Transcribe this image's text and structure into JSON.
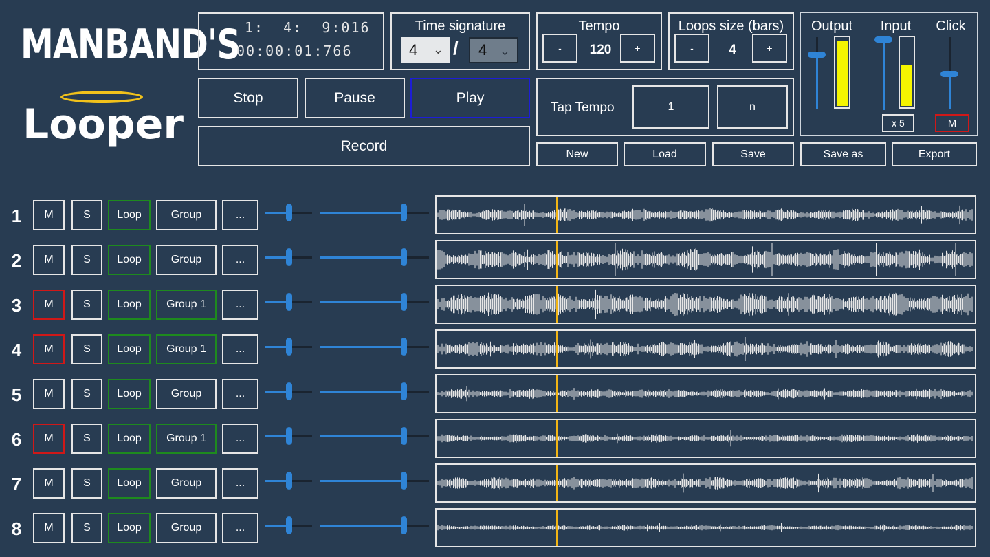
{
  "app": {
    "logo_top": "MANBAND'S",
    "logo_bottom": "Looper"
  },
  "counter": {
    "position": "1:  4:  9:016",
    "time": "00:00:01:766"
  },
  "time_signature": {
    "label": "Time signature",
    "numerator": "4",
    "separator": "/",
    "denominator": "4"
  },
  "tempo": {
    "label": "Tempo",
    "value": "120",
    "minus": "-",
    "plus": "+"
  },
  "loop_size": {
    "label": "Loops size (bars)",
    "value": "4",
    "minus": "-",
    "plus": "+"
  },
  "transport": {
    "stop": "Stop",
    "pause": "Pause",
    "play": "Play",
    "record": "Record"
  },
  "tap_tempo": {
    "label": "Tap Tempo",
    "button1": "1",
    "button2": "n"
  },
  "file": {
    "new": "New",
    "load": "Load",
    "save": "Save",
    "save_as": "Save as",
    "export": "Export"
  },
  "mixer": {
    "output_label": "Output",
    "input_label": "Input",
    "click_label": "Click",
    "input_gain": "x 5",
    "click_mute": "M",
    "output_level": 0.97,
    "input_level": 0.6
  },
  "colors": {
    "background": "#283c52",
    "accent": "#2f84d6",
    "loop_green": "#1e8a1e",
    "mute_red": "#d01818",
    "play_blue": "#1d1dd6",
    "playhead": "#f2b515",
    "meter": "#f5f500"
  },
  "tracks": [
    {
      "number": "1",
      "mute": "M",
      "solo": "S",
      "loop": "Loop",
      "group": "Group",
      "more": "...",
      "muted": false
    },
    {
      "number": "2",
      "mute": "M",
      "solo": "S",
      "loop": "Loop",
      "group": "Group",
      "more": "...",
      "muted": false
    },
    {
      "number": "3",
      "mute": "M",
      "solo": "S",
      "loop": "Loop",
      "group": "Group 1",
      "more": "...",
      "muted": true
    },
    {
      "number": "4",
      "mute": "M",
      "solo": "S",
      "loop": "Loop",
      "group": "Group 1",
      "more": "...",
      "muted": true
    },
    {
      "number": "5",
      "mute": "M",
      "solo": "S",
      "loop": "Loop",
      "group": "Group",
      "more": "...",
      "muted": false
    },
    {
      "number": "6",
      "mute": "M",
      "solo": "S",
      "loop": "Loop",
      "group": "Group 1",
      "more": "...",
      "muted": true
    },
    {
      "number": "7",
      "mute": "M",
      "solo": "S",
      "loop": "Loop",
      "group": "Group",
      "more": "...",
      "muted": false
    },
    {
      "number": "8",
      "mute": "M",
      "solo": "S",
      "loop": "Loop",
      "group": "Group",
      "more": "...",
      "muted": false
    }
  ]
}
